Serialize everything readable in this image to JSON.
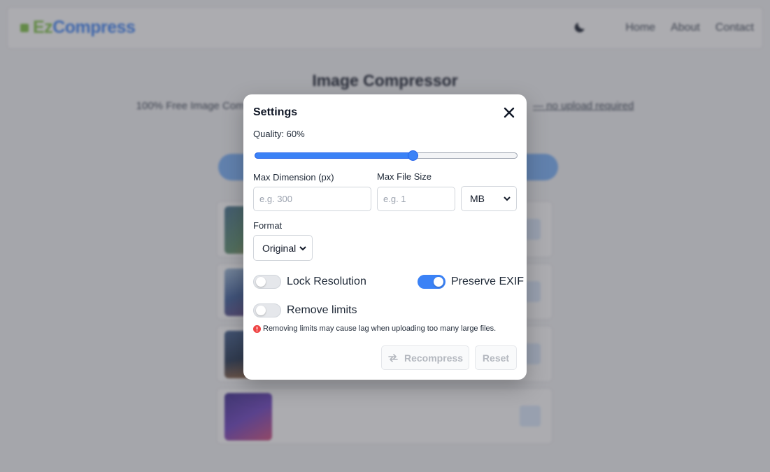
{
  "app": {
    "logo_ez": "Ez",
    "logo_compress": "Compress",
    "nav": [
      "Home",
      "About",
      "Contact"
    ]
  },
  "page": {
    "title": "Image Compressor",
    "subtitle_left": "100% Free Image Comp",
    "subtitle_right": "— no upload required"
  },
  "files": [
    {
      "name": "",
      "meta": "",
      "size": ""
    },
    {
      "name": "",
      "meta": "",
      "size": ""
    },
    {
      "name": "",
      "meta": "",
      "size": ""
    },
    {
      "name": "",
      "meta": "",
      "status": "",
      "size": ""
    }
  ],
  "settings": {
    "title": "Settings",
    "quality_label": "Quality: 60%",
    "quality_value": 60,
    "max_dimension": {
      "label": "Max Dimension (px)",
      "placeholder": "e.g. 300",
      "value": ""
    },
    "max_file_size": {
      "label": "Max File Size",
      "placeholder": "e.g. 1",
      "value": "",
      "unit": "MB"
    },
    "format": {
      "label": "Format",
      "value": "Original"
    },
    "toggles": {
      "lock_resolution": {
        "label": "Lock Resolution",
        "on": false
      },
      "preserve_exif": {
        "label": "Preserve EXIF",
        "on": true
      },
      "remove_limits": {
        "label": "Remove limits",
        "on": false
      }
    },
    "warning": "Removing limits may cause lag when uploading too many large files.",
    "recompress_label": "Recompress",
    "reset_label": "Reset"
  },
  "colors": {
    "accent": "#3b82f6",
    "brand_green": "#7cc242",
    "warning_red": "#ef4444"
  }
}
